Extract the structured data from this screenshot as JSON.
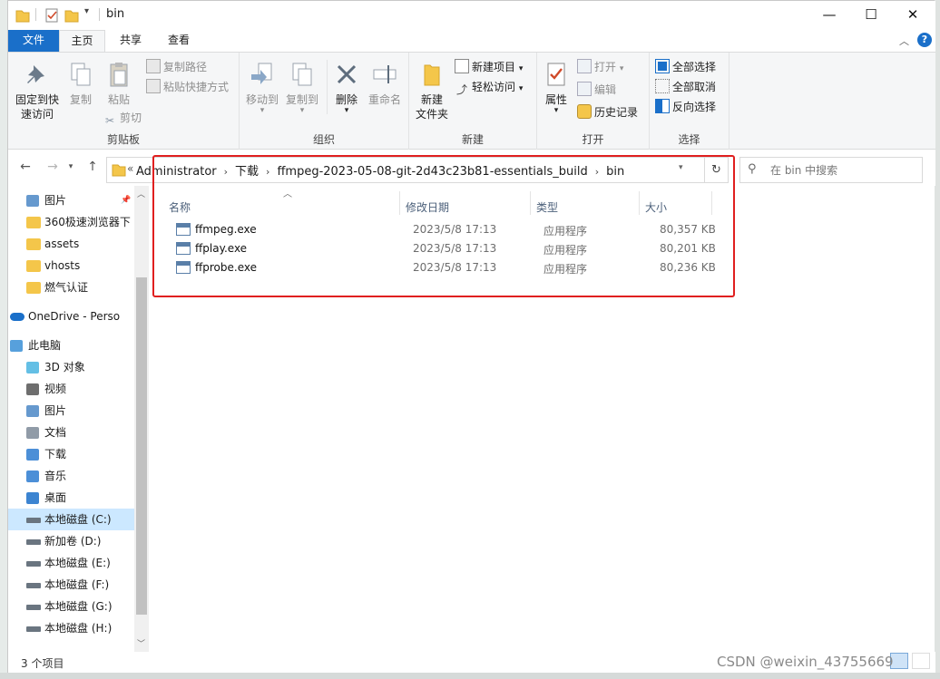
{
  "window": {
    "title": "bin",
    "caption": {
      "minimize": "—",
      "maximize": "☐",
      "close": "✕"
    }
  },
  "ribbon_tabs": [
    "文件",
    "主页",
    "共享",
    "查看"
  ],
  "ribbon": {
    "clipboard": {
      "pin_line1": "固定到快",
      "pin_line2": "速访问",
      "copy": "复制",
      "paste": "粘贴",
      "copy_path": "复制路径",
      "paste_shortcut": "粘贴快捷方式",
      "cut": "剪切",
      "label": "剪贴板"
    },
    "organize": {
      "move_to": "移动到",
      "copy_to": "复制到",
      "delete": "删除",
      "rename": "重命名",
      "label": "组织"
    },
    "new": {
      "new_folder_line1": "新建",
      "new_folder_line2": "文件夹",
      "new_item": "新建项目",
      "easy_access": "轻松访问",
      "label": "新建"
    },
    "open": {
      "properties": "属性",
      "open": "打开",
      "edit": "编辑",
      "history": "历史记录",
      "label": "打开"
    },
    "select": {
      "select_all": "全部选择",
      "select_none": "全部取消",
      "invert": "反向选择",
      "label": "选择"
    }
  },
  "address": {
    "prefix": "«",
    "crumbs": [
      "Administrator",
      "下载",
      "ffmpeg-2023-05-08-git-2d43c23b81-essentials_build",
      "bin"
    ]
  },
  "search": {
    "placeholder": "在 bin 中搜索"
  },
  "nav_pane": [
    {
      "label": "图片",
      "icon": "pictures-icon"
    },
    {
      "label": "360极速浏览器下",
      "icon": "folder-icon"
    },
    {
      "label": "assets",
      "icon": "folder-icon"
    },
    {
      "label": "vhosts",
      "icon": "folder-icon"
    },
    {
      "label": "燃气认证",
      "icon": "folder-icon"
    },
    {
      "label": "OneDrive - Perso",
      "icon": "onedrive-icon"
    },
    {
      "label": "此电脑",
      "icon": "this-pc-icon"
    },
    {
      "label": "3D 对象",
      "icon": "3d-objects-icon"
    },
    {
      "label": "视频",
      "icon": "videos-icon"
    },
    {
      "label": "图片",
      "icon": "pictures-icon"
    },
    {
      "label": "文档",
      "icon": "documents-icon"
    },
    {
      "label": "下载",
      "icon": "downloads-icon"
    },
    {
      "label": "音乐",
      "icon": "music-icon"
    },
    {
      "label": "桌面",
      "icon": "desktop-icon"
    },
    {
      "label": "本地磁盘 (C:)",
      "icon": "drive-c-icon"
    },
    {
      "label": "新加卷 (D:)",
      "icon": "drive-icon"
    },
    {
      "label": "本地磁盘 (E:)",
      "icon": "drive-icon"
    },
    {
      "label": "本地磁盘 (F:)",
      "icon": "drive-icon"
    },
    {
      "label": "本地磁盘 (G:)",
      "icon": "drive-icon"
    },
    {
      "label": "本地磁盘 (H:)",
      "icon": "drive-icon"
    }
  ],
  "columns": {
    "name": "名称",
    "modified": "修改日期",
    "type": "类型",
    "size": "大小"
  },
  "files": [
    {
      "name": "ffmpeg.exe",
      "modified": "2023/5/8 17:13",
      "type": "应用程序",
      "size": "80,357 KB"
    },
    {
      "name": "ffplay.exe",
      "modified": "2023/5/8 17:13",
      "type": "应用程序",
      "size": "80,201 KB"
    },
    {
      "name": "ffprobe.exe",
      "modified": "2023/5/8 17:13",
      "type": "应用程序",
      "size": "80,236 KB"
    }
  ],
  "status": {
    "item_count": "3 个项目"
  },
  "watermark": "CSDN @weixin_43755669",
  "colors": {
    "accent": "#1a6fc9",
    "highlight_box": "#e01f1f",
    "selected_nav": "#cce8ff"
  }
}
